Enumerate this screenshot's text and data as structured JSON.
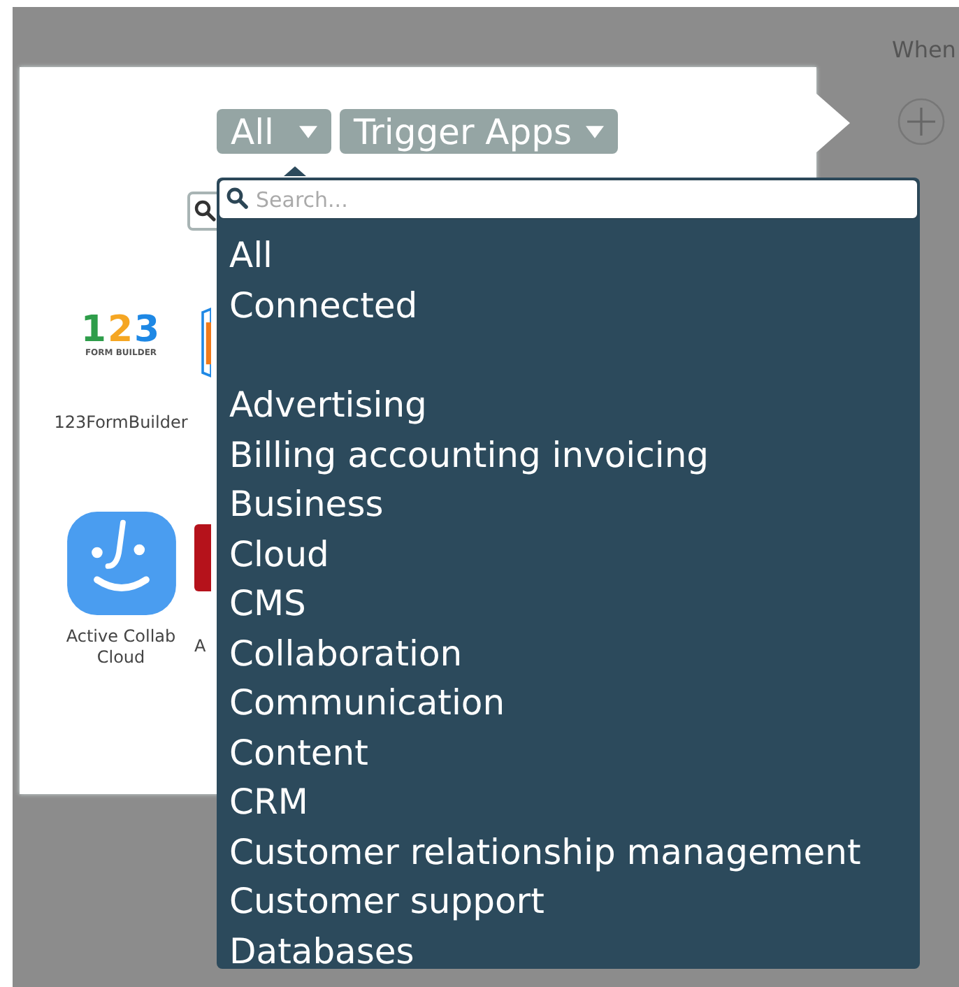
{
  "filters": [
    {
      "label": "All"
    },
    {
      "label": "Trigger Apps"
    }
  ],
  "next_step": {
    "label": "When"
  },
  "apps": [
    {
      "kind": "formbuilder",
      "logo_number": "123",
      "logo_caption": "FORM BUILDER",
      "name": "123FormBuilder"
    },
    {
      "kind": "partial-blue"
    },
    {
      "kind": "activecollab",
      "name": "Active Collab Cloud"
    },
    {
      "kind": "partial-red",
      "name": "A"
    }
  ],
  "dropdown": {
    "search": {
      "placeholder": "Search..."
    },
    "top_items": [
      "All",
      "Connected"
    ],
    "categories": [
      "Advertising",
      "Billing accounting invoicing",
      "Business",
      "Cloud",
      "CMS",
      "Collaboration",
      "Communication",
      "Content",
      "CRM",
      "Customer relationship management",
      "Customer support",
      "Databases"
    ]
  }
}
